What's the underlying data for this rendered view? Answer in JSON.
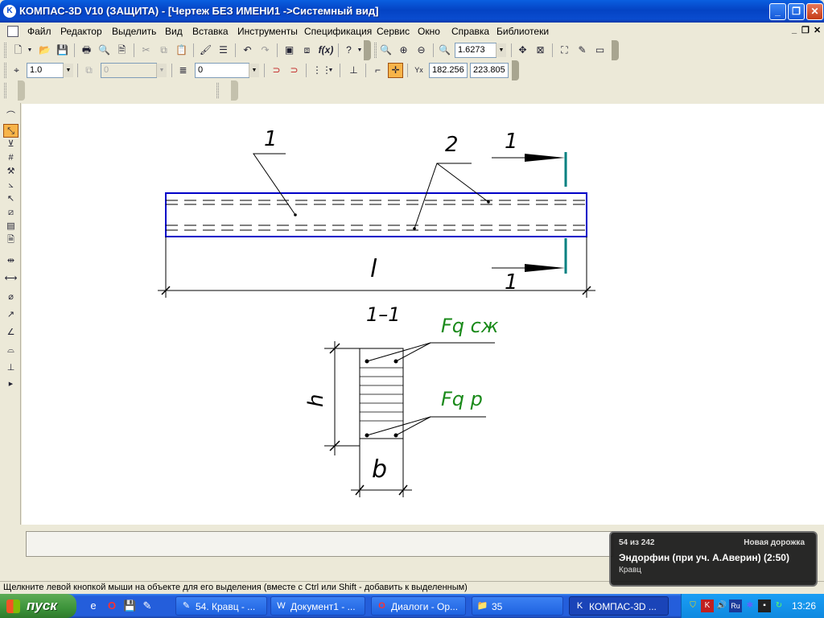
{
  "window": {
    "title": "КОМПАС-3D V10 (ЗАЩИТА) - [Чертеж БЕЗ ИМЕНИ1 ->Системный вид]"
  },
  "menu": [
    {
      "label": "Файл"
    },
    {
      "label": "Редактор"
    },
    {
      "label": "Выделить"
    },
    {
      "label": "Вид"
    },
    {
      "label": "Вставка"
    },
    {
      "label": "Инструменты"
    },
    {
      "label": "Спецификация"
    },
    {
      "label": "Сервис"
    },
    {
      "label": "Окно"
    },
    {
      "label": "Справка"
    },
    {
      "label": "Библиотеки"
    }
  ],
  "toolbar": {
    "zoom_value": "1.6273"
  },
  "props": {
    "step": "1.0",
    "style_value": "0",
    "layer_value": "0",
    "coord_x": "182.256",
    "coord_y": "223.805"
  },
  "drawing": {
    "label_1a": "1",
    "label_2": "2",
    "label_1_top": "1",
    "label_l": "l",
    "label_1_bottom": "1",
    "section_title": "1–1",
    "label_f_top": "Fq cж",
    "label_h": "h",
    "label_f_bottom": "Fq p",
    "label_b": "b"
  },
  "status": "Щелкните левой кнопкой мыши на объекте для его выделения (вместе с Ctrl или Shift - добавить к выделенным)",
  "notification": {
    "count": "54 из 242",
    "kind": "Новая дорожка",
    "track": "Эндорфин (при уч. А.Аверин)  (2:50)",
    "artist": "Кравц"
  },
  "taskbar": {
    "start": "пуск",
    "tasks": [
      {
        "label": "54. Кравц - ..."
      },
      {
        "label": "Документ1 - ..."
      },
      {
        "label": "Диалоги - Ор..."
      },
      {
        "label": "35"
      },
      {
        "label": "КОМПАС-3D ..."
      }
    ],
    "clock": "13:26"
  }
}
